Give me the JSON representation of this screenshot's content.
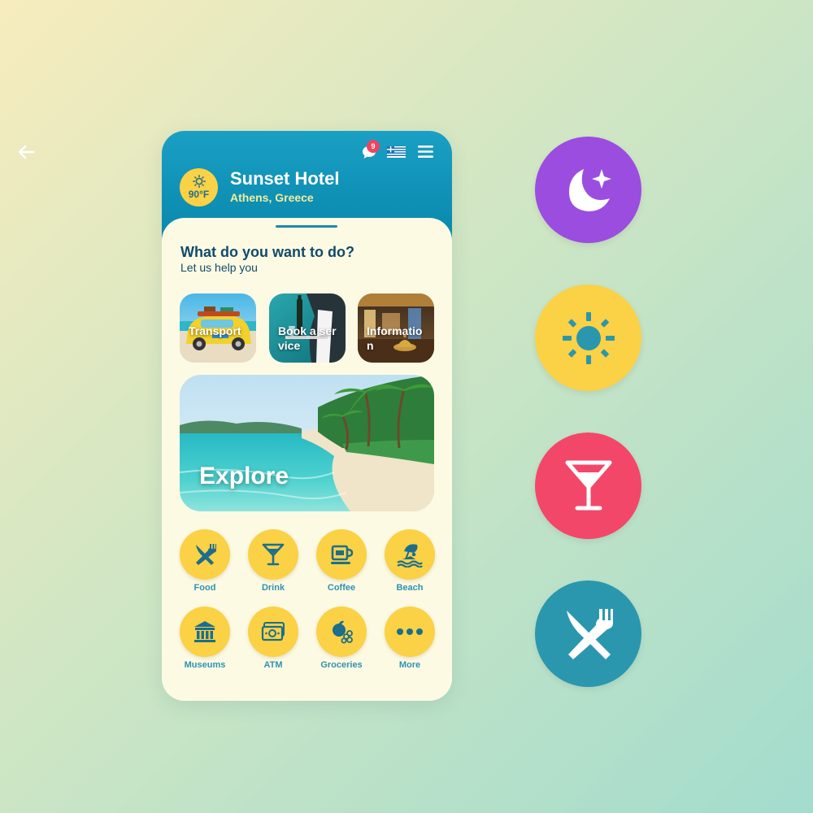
{
  "header": {
    "hotel_name": "Sunset Hotel",
    "location": "Athens, Greece",
    "temperature": "90°F",
    "notification_count": "9",
    "icons": [
      "arrow-left-icon",
      "chat-bubble-icon",
      "greek-flag-icon",
      "hamburger-menu-icon",
      "sun-icon"
    ]
  },
  "prompt": {
    "title": "What do you want to do?",
    "subtitle": "Let us help you"
  },
  "tiles": [
    {
      "label": "Transport"
    },
    {
      "label": "Book a service"
    },
    {
      "label": "Information"
    }
  ],
  "explore": {
    "label": "Explore"
  },
  "categories": [
    {
      "label": "Food",
      "icon": "fork-knife-icon"
    },
    {
      "label": "Drink",
      "icon": "cocktail-icon"
    },
    {
      "label": "Coffee",
      "icon": "coffee-cup-icon"
    },
    {
      "label": "Beach",
      "icon": "beach-umbrella-icon"
    },
    {
      "label": "Museums",
      "icon": "museum-icon"
    },
    {
      "label": "ATM",
      "icon": "money-icon"
    },
    {
      "label": "Groceries",
      "icon": "groceries-icon"
    },
    {
      "label": "More",
      "icon": "more-dots-icon"
    }
  ],
  "side_buttons": [
    {
      "icon": "moon-star-icon",
      "color": "#9b4de0"
    },
    {
      "icon": "sun-icon",
      "color": "#fbd145"
    },
    {
      "icon": "cocktail-icon",
      "color": "#f3476a"
    },
    {
      "icon": "fork-knife-icon",
      "color": "#2a97ae"
    }
  ],
  "colors": {
    "header_blue": "#0e8fb4",
    "accent_yellow": "#fbd145",
    "text_navy": "#114b6a",
    "label_teal": "#2e93ad",
    "badge_red": "#f0435f",
    "sheet_cream": "#fdfae4"
  }
}
